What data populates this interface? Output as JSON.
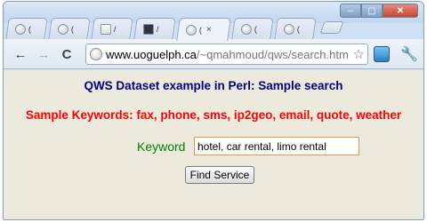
{
  "browser": {
    "tabs": [
      {
        "title": "(",
        "active": false
      },
      {
        "title": "(",
        "active": false
      },
      {
        "title": "/",
        "active": false
      },
      {
        "title": "/",
        "active": false
      },
      {
        "title": "(",
        "active": true,
        "close": "×"
      },
      {
        "title": "(",
        "active": false
      },
      {
        "title": "(",
        "active": false
      }
    ],
    "window_buttons": {
      "minimize": "–",
      "maximize": "▢",
      "close": "✕"
    },
    "nav": {
      "back": "←",
      "forward": "→",
      "reload": "C"
    },
    "url_domain": "www.uoguelph.ca",
    "url_path": "/~qmahmoud/qws/search.htm",
    "star": "☆",
    "wrench": "🔧"
  },
  "page": {
    "heading": "QWS Dataset example in Perl: Sample search",
    "keywords_line": "Sample Keywords: fax, phone, sms, ip2geo, email, quote, weather",
    "keyword_label": "Keyword",
    "keyword_value": "hotel, car rental, limo rental",
    "find_button": "Find Service"
  },
  "colors": {
    "heading": "#000080",
    "keywords": "#ff0000",
    "label": "#008000",
    "page_bg": "#eceadd"
  }
}
